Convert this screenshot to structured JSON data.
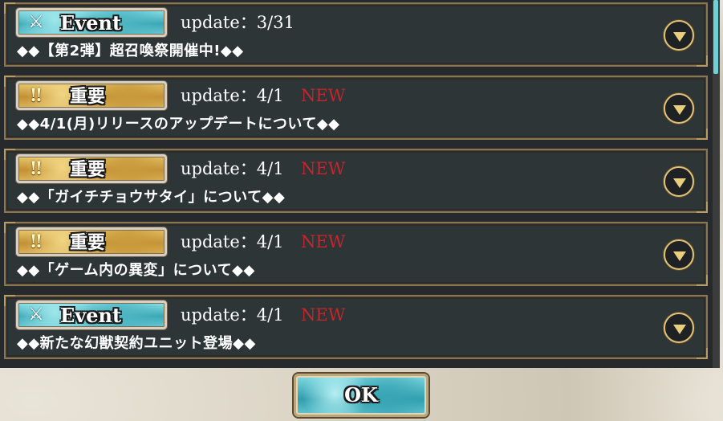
{
  "items": [
    {
      "type": "event",
      "badge_icon": "⚔",
      "badge_label": "Event",
      "update": "update：3/31",
      "new": "",
      "title": "◆◆【第2弾】超召喚祭開催中!◆◆"
    },
    {
      "type": "important",
      "badge_icon": "‼",
      "badge_label": "重要",
      "update": "update：4/1",
      "new": "NEW",
      "title": "◆◆4/1(月)リリースのアップデートについて◆◆"
    },
    {
      "type": "important",
      "badge_icon": "‼",
      "badge_label": "重要",
      "update": "update：4/1",
      "new": "NEW",
      "title": "◆◆「ガイチチョウサタイ」について◆◆"
    },
    {
      "type": "important",
      "badge_icon": "‼",
      "badge_label": "重要",
      "update": "update：4/1",
      "new": "NEW",
      "title": "◆◆「ゲーム内の異変」について◆◆"
    },
    {
      "type": "event",
      "badge_icon": "⚔",
      "badge_label": "Event",
      "update": "update：4/1",
      "new": "NEW",
      "title": "◆◆新たな幻獣契約ユニット登場◆◆"
    }
  ],
  "ok_label": "OK",
  "colors": {
    "new": "#c3262d",
    "event_badge": "#4fb6c3",
    "important_badge": "#c99b3c",
    "panel": "#2e3537",
    "border": "#8a7650"
  },
  "icons": {
    "event": "crossed-swords-icon",
    "important": "double-exclamation-icon",
    "expand": "chevron-down-icon"
  }
}
